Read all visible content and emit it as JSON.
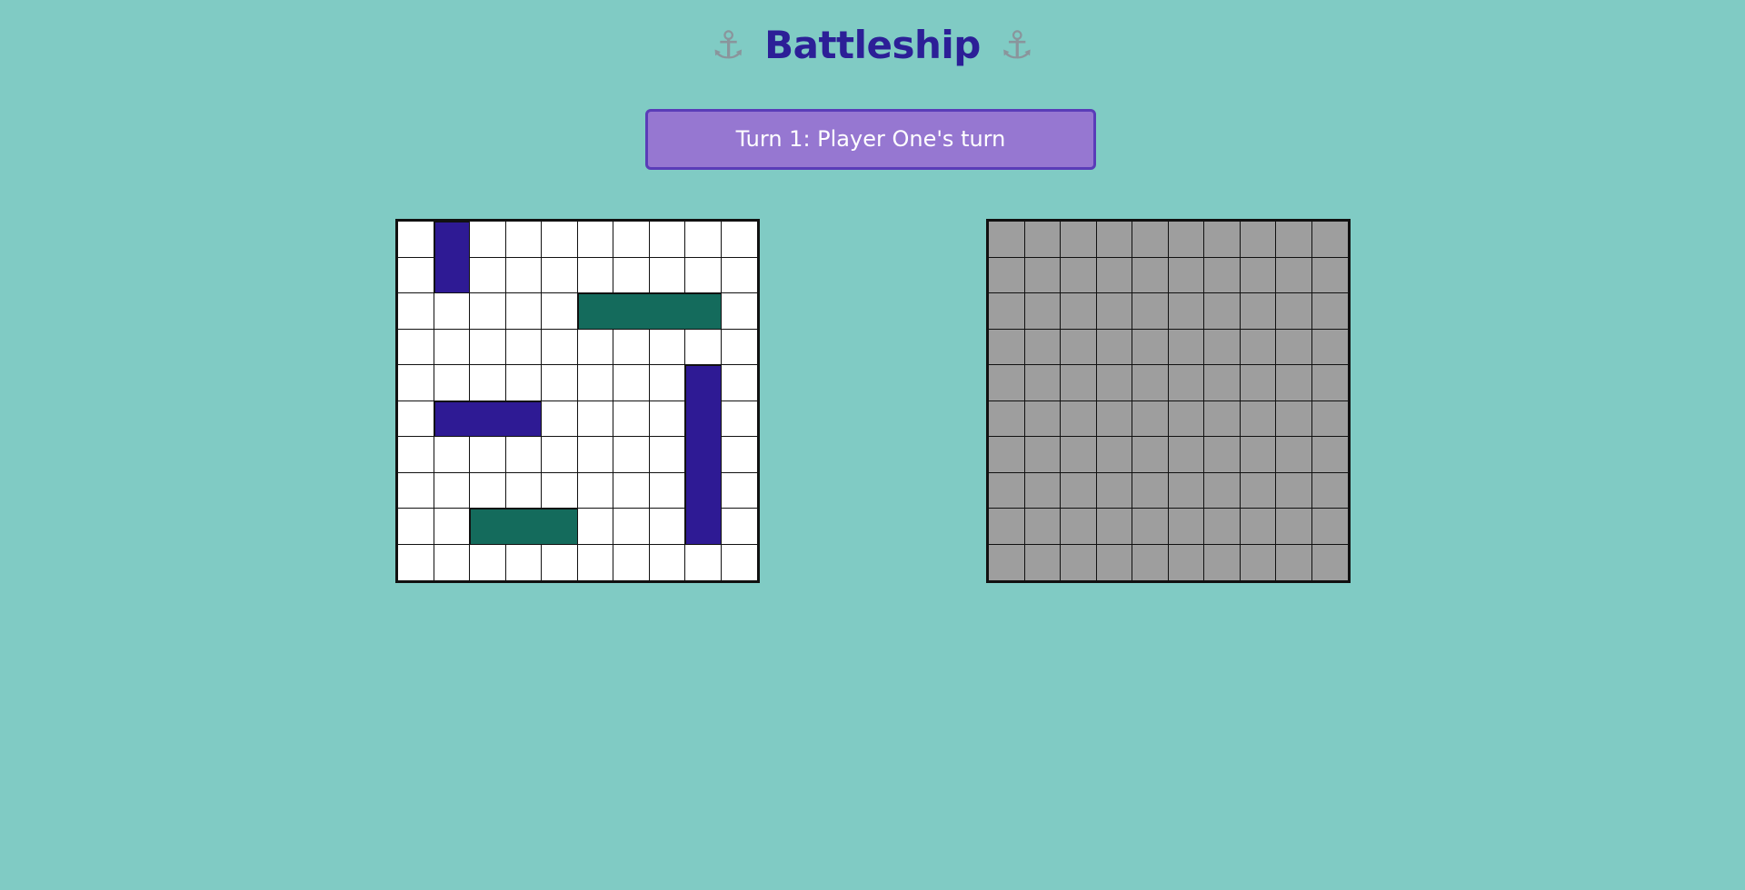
{
  "header": {
    "title": "Battleship",
    "left_icon": "anchor-icon",
    "right_icon": "anchor-icon",
    "icon_glyph": "⚓",
    "title_color": "#2c1f97"
  },
  "status": {
    "text": "Turn 1: Player One's turn",
    "background": "#9677d1",
    "border": "#5a3cb8"
  },
  "colors": {
    "background": "#80cbc4",
    "sea": "#ffffff",
    "fog": "#9e9e9e",
    "ship_navy": "#2e1a94",
    "ship_teal": "#146b5c"
  },
  "own_board": {
    "rows": 10,
    "cols": 10,
    "ships": [
      {
        "row": 0,
        "col": 1,
        "length": 2,
        "orientation": "vertical",
        "color": "#2e1a94"
      },
      {
        "row": 2,
        "col": 5,
        "length": 4,
        "orientation": "horizontal",
        "color": "#146b5c"
      },
      {
        "row": 4,
        "col": 8,
        "length": 5,
        "orientation": "vertical",
        "color": "#2e1a94"
      },
      {
        "row": 5,
        "col": 1,
        "length": 3,
        "orientation": "horizontal",
        "color": "#2e1a94"
      },
      {
        "row": 8,
        "col": 2,
        "length": 3,
        "orientation": "horizontal",
        "color": "#146b5c"
      }
    ]
  },
  "enemy_board": {
    "rows": 10,
    "cols": 10,
    "state": "unrevealed"
  }
}
